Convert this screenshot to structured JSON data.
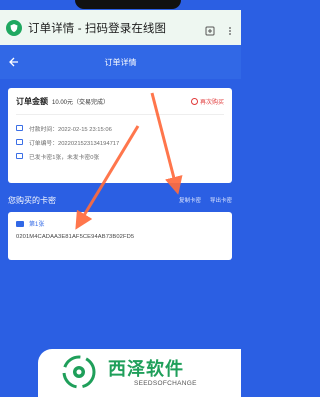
{
  "browser": {
    "title": "订单详情 - 扫码登录在线图",
    "icons": [
      "shield-icon",
      "bookmark-icon",
      "more-icon"
    ]
  },
  "header": {
    "title": "订单详情",
    "back_icon": "back-arrow-icon"
  },
  "order": {
    "amount_label": "订单金额",
    "amount_value": "10.00元（交易完成）",
    "rebuy_label": "再次购买",
    "info": [
      {
        "icon": "calendar-icon",
        "text": "付款时间：2022-02-15 23:15:06"
      },
      {
        "icon": "receipt-icon",
        "text": "订单编号：2022021523134194717"
      },
      {
        "icon": "mail-icon",
        "text": "已发卡密1张，未发卡密0张"
      }
    ]
  },
  "purchased": {
    "section_title": "您购买的卡密",
    "copy_link": "复制卡密",
    "export_link": "导出卡密",
    "card_label": "第1张",
    "card_code": "0201M4CADAA3E81AF5CE94AB73B02FD5"
  },
  "watermark": {
    "brand": "西泽软件",
    "sub": "SEEDSOFCHANGE"
  },
  "colors": {
    "page_bg": "#2b5fe3",
    "header_bg": "#3168e6",
    "accent_red": "#e13a3a",
    "arrow": "#ff6b3d",
    "brand_green": "#1f9f5a"
  }
}
